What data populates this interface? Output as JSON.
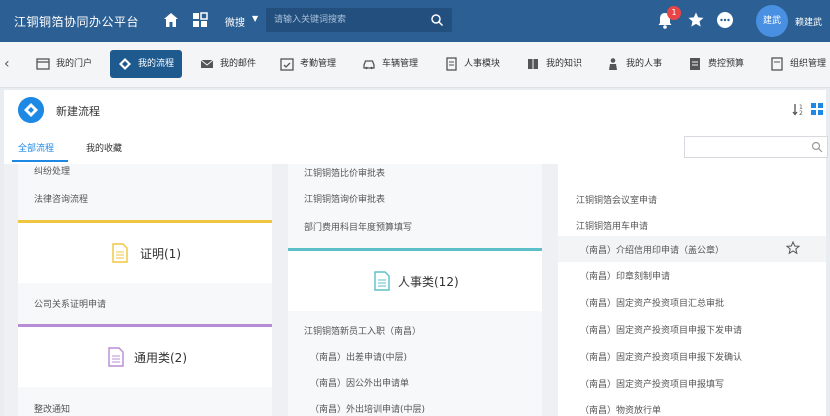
{
  "header": {
    "title": "江铜铜箔协同办公平台",
    "micro_label": "微搜",
    "search_placeholder": "请输入关键词搜索",
    "notification_count": "1",
    "avatar_text": "建武",
    "username": "赖建武"
  },
  "nav": {
    "items": [
      {
        "label": "我的门户",
        "icon": "portal-icon"
      },
      {
        "label": "我的流程",
        "icon": "workflow-icon",
        "active": true
      },
      {
        "label": "我的邮件",
        "icon": "mail-icon"
      },
      {
        "label": "考勤管理",
        "icon": "calendar-check-icon"
      },
      {
        "label": "车辆管理",
        "icon": "car-icon"
      },
      {
        "label": "人事模块",
        "icon": "document-icon"
      },
      {
        "label": "我的知识",
        "icon": "book-icon"
      },
      {
        "label": "我的人事",
        "icon": "person-icon"
      },
      {
        "label": "费控预算",
        "icon": "budget-icon"
      },
      {
        "label": "组织管理",
        "icon": "org-icon"
      }
    ]
  },
  "panel": {
    "title": "新建流程",
    "tabs": [
      "全部流程",
      "我的收藏"
    ]
  },
  "col1": {
    "items_top": [
      "纠纷处理",
      "法律咨询流程"
    ],
    "card1": {
      "title": "证明(1)",
      "color": "#f0c53f",
      "items": [
        "公司关系证明申请"
      ]
    },
    "card2": {
      "title": "通用类(2)",
      "color": "#b98cd6",
      "items": [
        "整改通知"
      ]
    }
  },
  "col2": {
    "items_top": [
      "江铜铜箔比价审批表",
      "江铜铜箔询价审批表",
      "部门费用科目年度预算填写"
    ],
    "card": {
      "title": "人事类(12)",
      "color": "#5bc0c8",
      "items": [
        "江铜铜箔新员工入职（南昌）",
        "（南昌）出差申请(中层)",
        "（南昌）因公外出申请单",
        "（南昌）外出培训申请(中层)"
      ]
    }
  },
  "col3": {
    "items": [
      "江铜铜箔会议室申请",
      "江铜铜箔用车申请",
      "（南昌）介绍信用印申请（盖公章）",
      "（南昌）印章刻制申请",
      "（南昌）固定资产投资项目汇总审批",
      "（南昌）固定资产投资项目申报下发申请",
      "（南昌）固定资产投资项目申报下发确认",
      "（南昌）固定资产投资项目申报填写",
      "（南昌）物资放行单"
    ]
  }
}
